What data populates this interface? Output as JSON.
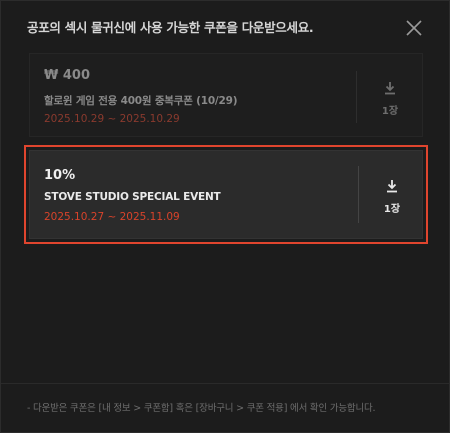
{
  "modal": {
    "title": "공포의 섹시 물귀신에 사용 가능한 쿠폰을 다운받으세요.",
    "close_icon": "close-icon"
  },
  "coupons": [
    {
      "amount": "₩ 400",
      "name": "할로윈 게임 전용 400원 중복쿠폰 (10/29)",
      "period": "2025.10.29 ~ 2025.10.29",
      "count": "1장",
      "state": "disabled",
      "icon": "download-icon"
    },
    {
      "amount": "10%",
      "name": "STOVE STUDIO SPECIAL EVENT",
      "period": "2025.10.27 ~ 2025.11.09",
      "count": "1장",
      "state": "highlighted",
      "icon": "download-icon"
    }
  ],
  "footer": {
    "note": "- 다운받은 쿠폰은 [내 정보 > 쿠폰함] 혹은 [장바구니 > 쿠폰 적용] 에서 확인 가능합니다."
  },
  "colors": {
    "highlight_border": "#e0452e",
    "period_text": "#d8432b",
    "background": "#1c1c1c"
  }
}
